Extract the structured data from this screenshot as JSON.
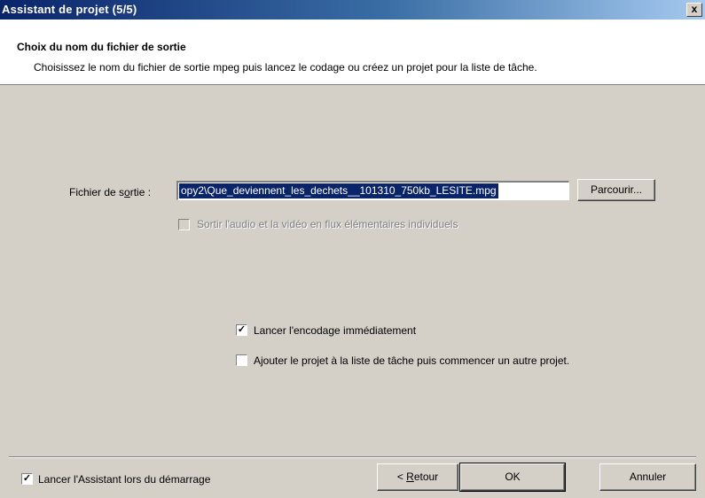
{
  "window": {
    "title": "Assistant de projet (5/5)",
    "close_glyph": "x"
  },
  "header": {
    "title": "Choix du nom du fichier de sortie",
    "subtitle": "Choisissez le nom du fichier de sortie mpeg puis lancez le codage ou créez un projet pour la liste de tâche."
  },
  "output": {
    "label_pre": "Fichier de s",
    "label_u": "o",
    "label_post": "rtie :",
    "value": "opy2\\Que_deviennent_les_dechets__101310_750kb_LESITE.mpg",
    "browse_label": "Parcourir..."
  },
  "options": {
    "split_label": "Sortir l'audio et la vidéo en flux élémentaires individuels",
    "split_checked": false,
    "encode_now_label": "Lancer l'encodage immédiatement",
    "encode_now_checked": true,
    "add_project_label": "Ajouter le projet à la liste de tâche puis commencer un autre projet.",
    "add_project_checked": false
  },
  "footer": {
    "startup_label": "Lancer l'Assistant lors du démarrage",
    "startup_checked": true,
    "back_pre": "< ",
    "back_u": "R",
    "back_post": "etour",
    "ok_label": "OK",
    "cancel_label": "Annuler"
  },
  "icons": {
    "check": "✓"
  },
  "colors": {
    "selection": "#0a246a",
    "titlebar": "#0a246a",
    "face": "#d4d0c8"
  }
}
